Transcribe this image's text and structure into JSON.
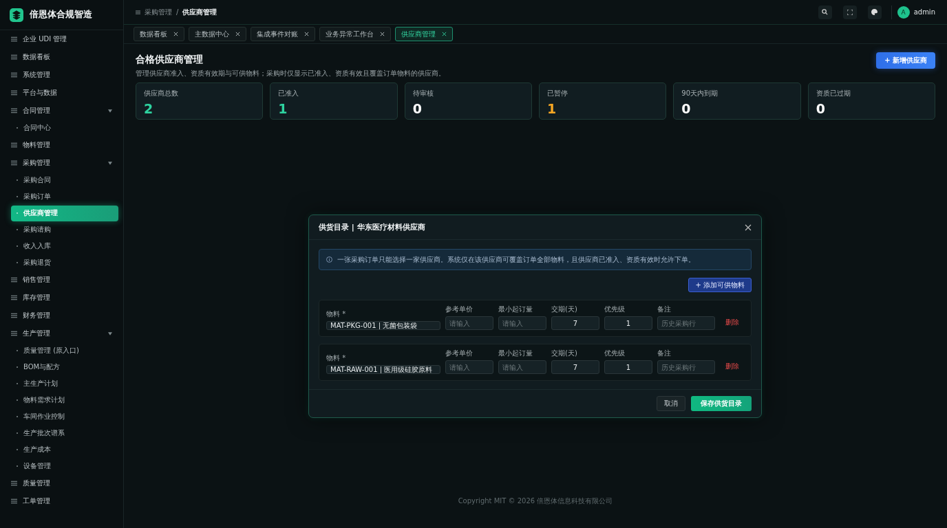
{
  "brand": {
    "name": "倍恩体合规智造"
  },
  "sidebar": {
    "items": [
      {
        "label": "企业 UDI 管理",
        "selected": false
      },
      {
        "label": "数据看板",
        "selected": false
      },
      {
        "label": "系统管理",
        "selected": false
      },
      {
        "label": "平台与数据",
        "selected": false
      },
      {
        "label": "合同管理",
        "selected": false,
        "expanded": true,
        "children": [
          {
            "label": "合同中心",
            "selected": false
          }
        ]
      },
      {
        "label": "物料管理",
        "selected": false
      },
      {
        "label": "采购管理",
        "selected": false,
        "expanded": true,
        "children": [
          {
            "label": "采购合同",
            "selected": false
          },
          {
            "label": "采购订单",
            "selected": false
          },
          {
            "label": "供应商管理",
            "selected": true
          },
          {
            "label": "采购请购",
            "selected": false
          },
          {
            "label": "收入入库",
            "selected": false
          },
          {
            "label": "采购退货",
            "selected": false
          }
        ]
      },
      {
        "label": "销售管理",
        "selected": false
      },
      {
        "label": "库存管理",
        "selected": false
      },
      {
        "label": "财务管理",
        "selected": false
      },
      {
        "label": "生产管理",
        "selected": false,
        "expanded": true,
        "children": [
          {
            "label": "质量管理 (原入口)",
            "selected": false
          },
          {
            "label": "BOM与配方",
            "selected": false
          },
          {
            "label": "主生产计划",
            "selected": false
          },
          {
            "label": "物料需求计划",
            "selected": false
          },
          {
            "label": "车间作业控制",
            "selected": false
          },
          {
            "label": "生产批次谱系",
            "selected": false
          },
          {
            "label": "生产成本",
            "selected": false
          },
          {
            "label": "设备管理",
            "selected": false
          }
        ]
      },
      {
        "label": "质量管理",
        "selected": false
      },
      {
        "label": "工单管理",
        "selected": false
      }
    ]
  },
  "breadcrumb": [
    "采购管理",
    "/",
    "供应商管理"
  ],
  "user": {
    "avatar": "A",
    "name": "admin"
  },
  "tabs": [
    {
      "label": "数据看板",
      "selected": false
    },
    {
      "label": "主数据中心",
      "selected": false
    },
    {
      "label": "集成事件对账",
      "selected": false
    },
    {
      "label": "业务异常工作台",
      "selected": false
    },
    {
      "label": "供应商管理",
      "selected": true
    }
  ],
  "page": {
    "title": "合格供应商管理",
    "subtitle": "管理供应商准入、资质有效期与可供物料；采购时仅显示已准入、资质有效且覆盖订单物料的供应商。",
    "add_button": "+ 新增供应商"
  },
  "stats": [
    {
      "label": "供应商总数",
      "value": "2",
      "color": "#2ed3a0"
    },
    {
      "label": "已准入",
      "value": "1",
      "color": "#2ed3a0"
    },
    {
      "label": "待审核",
      "value": "0",
      "color": "#ffffff"
    },
    {
      "label": "已暂停",
      "value": "1",
      "color": "#f5a623"
    },
    {
      "label": "90天内到期",
      "value": "0",
      "color": "#ffffff"
    },
    {
      "label": "资质已过期",
      "value": "0",
      "color": "#ffffff"
    }
  ],
  "dialog": {
    "title": "供货目录 | 华东医疗材料供应商",
    "notice": "一张采购订单只能选择一家供应商。系统仅在该供应商可覆盖订单全部物料，且供应商已准入、资质有效时允许下单。",
    "add_button": "+ 添加可供物料",
    "rows": [
      {
        "fields": [
          {
            "label": "物料 *",
            "kind": "text",
            "value": "MAT-PKG-001 | 无菌包装袋"
          },
          {
            "label": "参考单价",
            "kind": "text",
            "placeholder": "请输入"
          },
          {
            "label": "最小起订量",
            "kind": "text",
            "placeholder": "请输入"
          },
          {
            "label": "交期(天)",
            "kind": "number",
            "value": "7"
          },
          {
            "label": "优先级",
            "kind": "number",
            "value": "1"
          },
          {
            "label": "备注",
            "kind": "text",
            "placeholder": "历史采购行"
          }
        ],
        "delete": "删除"
      },
      {
        "fields": [
          {
            "label": "物料 *",
            "kind": "text",
            "value": "MAT-RAW-001 | 医用级硅胶原料"
          },
          {
            "label": "参考单价",
            "kind": "text",
            "placeholder": "请输入"
          },
          {
            "label": "最小起订量",
            "kind": "text",
            "placeholder": "请输入"
          },
          {
            "label": "交期(天)",
            "kind": "number",
            "value": "7"
          },
          {
            "label": "优先级",
            "kind": "number",
            "value": "1"
          },
          {
            "label": "备注",
            "kind": "text",
            "placeholder": "历史采购行"
          }
        ],
        "delete": "删除"
      }
    ],
    "cancel": "取消",
    "save": "保存供货目录"
  },
  "footer": "Copyright MIT © 2026 倍恩体信息科技有限公司"
}
